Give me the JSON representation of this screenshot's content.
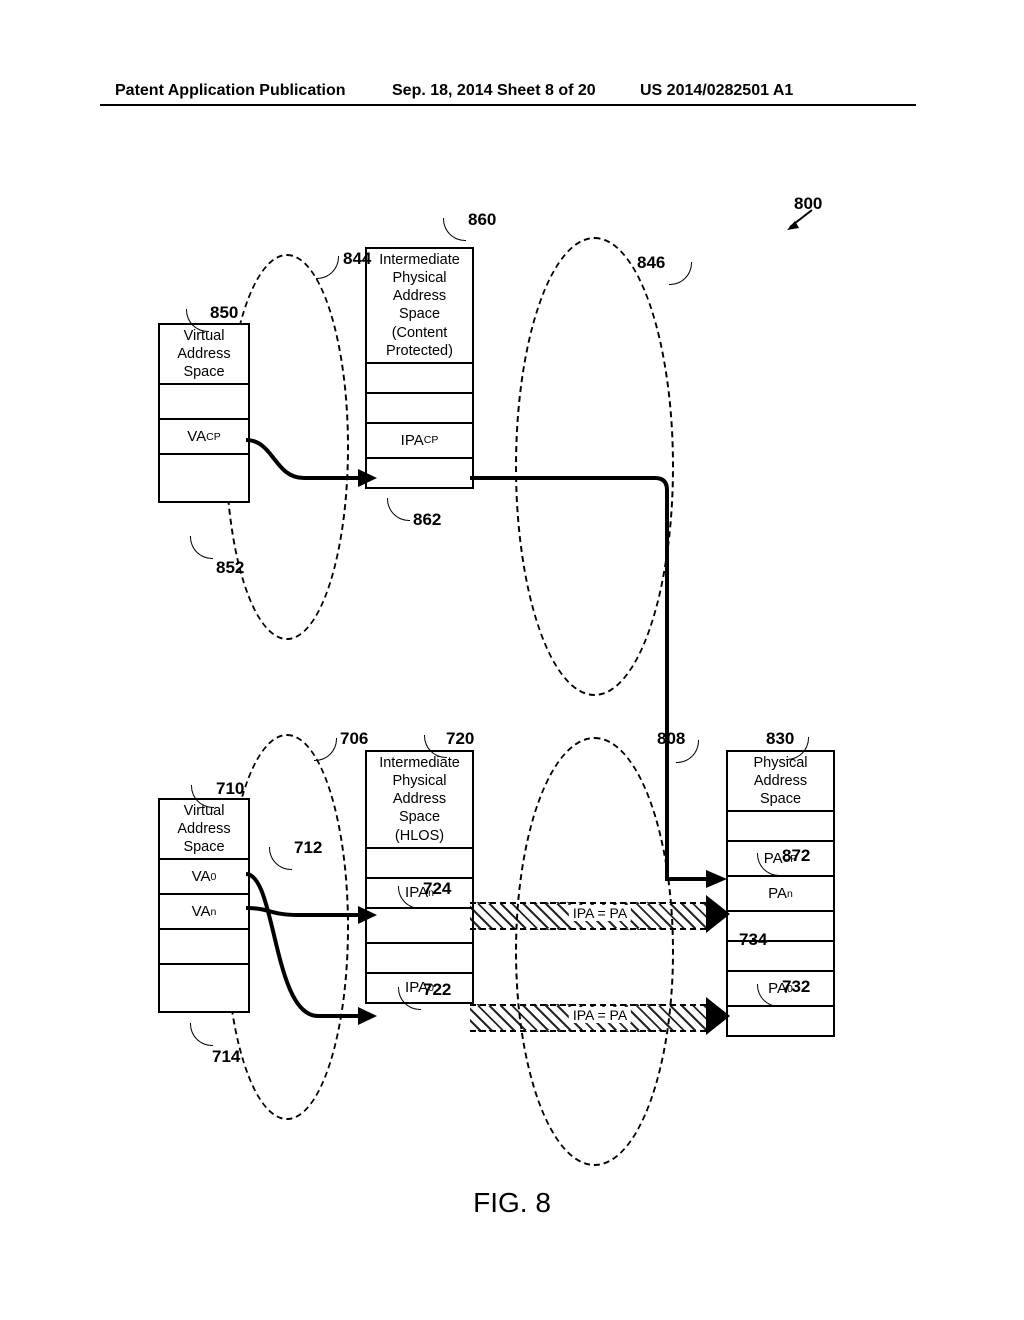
{
  "header": {
    "left": "Patent Application Publication",
    "center": "Sep. 18, 2014   Sheet 8 of 20",
    "right": "US 2014/0282501 A1"
  },
  "caption": "FIG. 8",
  "top": {
    "va": {
      "title": "Virtual\nAddress\nSpace",
      "rows": [
        "",
        "VA_CP",
        ""
      ]
    },
    "ipa": {
      "title": "Intermediate\nPhysical\nAddress\nSpace\n(Content\nProtected)",
      "rows": [
        "",
        "",
        "IPA_CP",
        ""
      ]
    }
  },
  "bot": {
    "va": {
      "title": "Virtual\nAddress\nSpace",
      "rows": [
        "VA_0",
        "VA_n",
        "",
        ""
      ]
    },
    "ipa": {
      "title": "Intermediate\nPhysical\nAddress\nSpace\n(HLOS)",
      "rows": [
        "",
        "IPA_n",
        "",
        "",
        "IPA_0"
      ]
    },
    "pa": {
      "title": "Physical\nAddress\nSpace",
      "rows": [
        "",
        "PA_CP",
        "PA_n",
        "",
        "",
        "PA_0",
        ""
      ]
    }
  },
  "maps": {
    "top": "IPA = PA",
    "bot": "IPA = PA"
  },
  "refs": {
    "r800": "800",
    "r844": "844",
    "r846": "846",
    "r850": "850",
    "r860": "860",
    "r852": "852",
    "r862": "862",
    "r706": "706",
    "r720": "720",
    "r808": "808",
    "r830": "830",
    "r710": "710",
    "r712": "712",
    "r714": "714",
    "r722": "722",
    "r724": "724",
    "r732": "732",
    "r734": "734",
    "r872": "872"
  }
}
